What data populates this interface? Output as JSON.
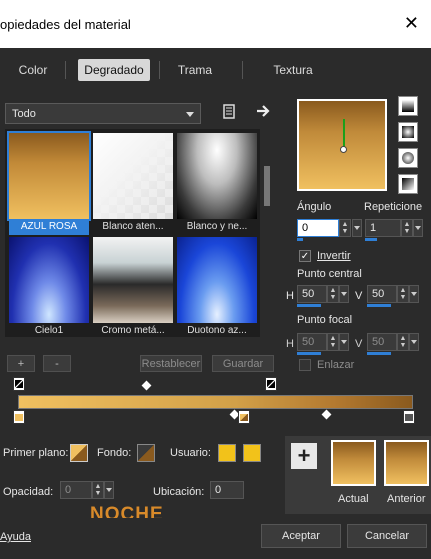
{
  "window": {
    "title": "opiedades del material",
    "close_glyph": "✕"
  },
  "tabs": [
    {
      "label": "Color"
    },
    {
      "label": "Degradado"
    },
    {
      "label": "Trama"
    },
    {
      "label": "Textura"
    }
  ],
  "library": {
    "selected_category": "Todo",
    "items": [
      {
        "label": "AZUL ROSA"
      },
      {
        "label": "Blanco aten..."
      },
      {
        "label": "Blanco y ne..."
      },
      {
        "label": "Cielo1"
      },
      {
        "label": "Cromo metá..."
      },
      {
        "label": "Duotono az..."
      }
    ],
    "add_label": "+",
    "remove_label": "-",
    "reset_label": "Restablecer",
    "save_label": "Guardar"
  },
  "settings": {
    "angle_label": "Ángulo",
    "angle_value": "0",
    "repeat_label": "Repeticione",
    "repeat_value": "1",
    "invert_label": "Invertir",
    "invert_checked": true,
    "center_label": "Punto central",
    "center_h_label": "H",
    "center_h_value": "50",
    "center_v_label": "V",
    "center_v_value": "50",
    "focal_label": "Punto focal",
    "focal_h_label": "H",
    "focal_h_value": "50",
    "focal_v_label": "V",
    "focal_v_value": "50",
    "link_label": "Enlazar"
  },
  "gradient_editor": {
    "foreground_label": "Primer plano:",
    "background_label": "Fondo:",
    "user_label": "Usuario:",
    "opacity_label": "Opacidad:",
    "opacity_value": "0",
    "location_label": "Ubicación:",
    "location_value": "0",
    "watermark": "NOCHE",
    "add_glyph": "+",
    "current_label": "Actual",
    "previous_label": "Anterior",
    "colors": {
      "light_gold": "#f0c060",
      "dark_brown": "#8a5a1e",
      "user_yellow": "#f2c21a"
    }
  },
  "footer": {
    "help_label": "Ayuda",
    "ok_label": "Aceptar",
    "cancel_label": "Cancelar"
  }
}
